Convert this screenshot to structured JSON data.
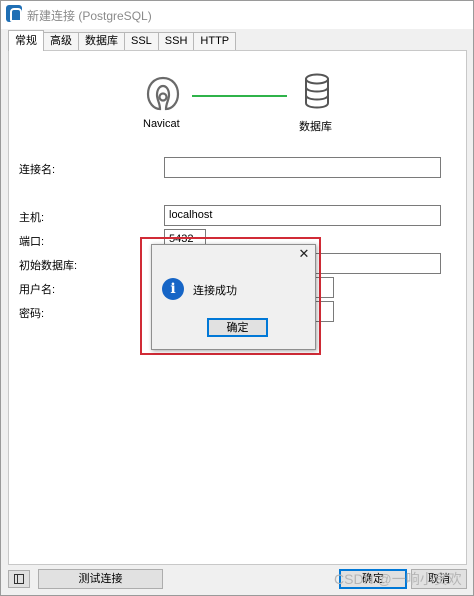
{
  "window": {
    "title": "新建连接 (PostgreSQL)"
  },
  "tabs": [
    {
      "label": "常规",
      "active": true
    },
    {
      "label": "高级",
      "active": false
    },
    {
      "label": "数据库",
      "active": false
    },
    {
      "label": "SSL",
      "active": false
    },
    {
      "label": "SSH",
      "active": false
    },
    {
      "label": "HTTP",
      "active": false
    }
  ],
  "diagram": {
    "left_label": "Navicat",
    "right_label": "数据库",
    "line_color": "#2fb34a"
  },
  "form": {
    "connection_name": {
      "label": "连接名:",
      "value": ""
    },
    "host": {
      "label": "主机:",
      "value": "localhost"
    },
    "port": {
      "label": "端口:",
      "value": "5432"
    },
    "initial_database": {
      "label": "初始数据库:",
      "value": ""
    },
    "username": {
      "label": "用户名:",
      "value": ""
    },
    "password": {
      "label": "密码:",
      "value": ""
    }
  },
  "footer": {
    "test_button": "测试连接",
    "ok_button": "确定",
    "cancel_button": "取消",
    "watermark": "CSDN @一响小贪欢"
  },
  "dialog": {
    "message": "连接成功",
    "ok_button": "确定",
    "close_glyph": "✕",
    "info_glyph": "i",
    "highlight_color": "#d12b36"
  }
}
